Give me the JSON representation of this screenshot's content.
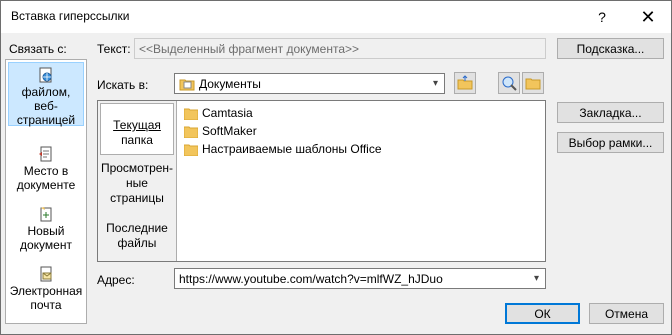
{
  "title": "Вставка гиперссылки",
  "titlebar": {
    "help_label": "?",
    "close_label": "✕"
  },
  "link_to": {
    "label": "Связать с:",
    "items": [
      {
        "label": "файлом, веб-страницей",
        "line1": "файлом, веб-",
        "line2": "страницей",
        "icon": "globe-page-icon",
        "selected": true
      },
      {
        "label": "местом в документе",
        "line1": "Место в",
        "line2": "документе",
        "icon": "place-in-document-icon",
        "selected": false
      },
      {
        "label": "новым документом",
        "line1": "Новый",
        "line2": "документ",
        "icon": "new-document-icon",
        "selected": false
      },
      {
        "label": "электронной почтой",
        "line1": "Электронная",
        "line2": "почта",
        "icon": "email-icon",
        "selected": false
      }
    ]
  },
  "text_field": {
    "label": "Текст:",
    "value": "<<Выделенный фрагмент документа>>"
  },
  "screentip_button": "Подсказка...",
  "look_in": {
    "label": "Искать в:",
    "value": "Документы"
  },
  "look_in_pane": {
    "items": [
      {
        "line1": "Текущая",
        "line2": "папка",
        "line3": "",
        "selected": true
      },
      {
        "line1": "Просмотрен-",
        "line2": "ные",
        "line3": "страницы",
        "selected": false
      },
      {
        "line1": "Последние",
        "line2": "файлы",
        "line3": "",
        "selected": false
      }
    ]
  },
  "files": [
    "Camtasia",
    "SoftMaker",
    "Настраиваемые шаблоны Office"
  ],
  "bookmark_button": "Закладка...",
  "target_frame_button": "Выбор рамки...",
  "address": {
    "label": "Адрес:",
    "value": "https://www.youtube.com/watch?v=mlfWZ_hJDuo"
  },
  "ok_button": "ОК",
  "cancel_button": "Отмена",
  "colors": {
    "accent": "#0078d7",
    "selection": "#cce8ff",
    "folder": "#f2c55c"
  }
}
